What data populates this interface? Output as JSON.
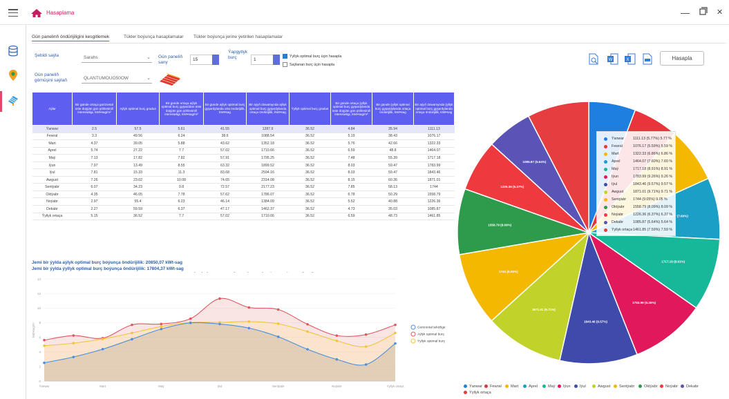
{
  "app": {
    "title": "Hasaplama"
  },
  "tabs": [
    {
      "label": "Gün panelinň öndürijiligini kesgitlemek",
      "active": true
    },
    {
      "label": "Tükler boýunça hasaplamalar",
      "active": false
    },
    {
      "label": "Tükler boýunça jerine ýetirilen hasaplamalar",
      "active": false
    }
  ],
  "form": {
    "city_label": "Şebidi saýla",
    "city_value": "Sarahs",
    "panel_count_label_1": "Gün paneliň",
    "panel_count_label_2": "sany",
    "panel_count_value": "15",
    "tilt_label_1": "Ýapgytlyk",
    "tilt_label_2": "burç",
    "tilt_value": "1",
    "chk_yearly_label": "Ýyllyk optimal burç üçin hasapla",
    "chk_yearly_checked": true,
    "chk_selected_label": "Saýlanan burç üçin hasapla",
    "chk_selected_checked": false,
    "panel_type_label_1": "Gün paneliň",
    "panel_type_label_2": "görnüşini saýlaň",
    "panel_type_value": "QLANTUMOUO50OW",
    "calc_button": "Hasapla"
  },
  "table": {
    "headers": [
      "Aýlar",
      "Bir günde ortaça gorizontal üste düşýän gün şöhlesiniň intensiwligi, kWt•sag/m²",
      "Aýlyk optimal burç gradus",
      "Bir günde ortaça aýlyk optimal burç gyşarddan üste düşýän gün şöhlesiniň intensiwligi, kWt•sag/m²",
      "Bir günde aýlyk optimal burç gyşardylanda orta öndürijilik, kWt•sag",
      "Bir aýyň dowamynda aýlyk optimal burç gyşardylanda ortaça öndürijilik, kWt•sag",
      "Ýyllyk optimal burç gradus",
      "Bir günde ortaça ýyllyk optimal burç gyşardylanda üste düşýän gün şöhlesiniň intensiwligi, kWt•sag/m²",
      "Bir günde ýyllyk optimal burç gyşardylanda ortaça öndürijilik, kWt•sag",
      "Bir aýyň dowamynda ýyllyk optimal burç gyşardylanda ortaça öndürijilik, kWt•sag"
    ],
    "rows": [
      [
        "Ýanwar",
        "2.5",
        "57.5",
        "5.61",
        "41.55",
        "1287.9",
        "36.52",
        "4.84",
        "35.94",
        "1111.13"
      ],
      [
        "Fewral",
        "3.3",
        "49.56",
        "6.24",
        "38.6",
        "1088.54",
        "36.52",
        "5.19",
        "38.43",
        "1076.17"
      ],
      [
        "Mart",
        "4.37",
        "39.05",
        "5.88",
        "43.62",
        "1352.18",
        "36.52",
        "5.76",
        "42.66",
        "1322.33"
      ],
      [
        "Aprel",
        "5.74",
        "27.22",
        "7.7",
        "57.02",
        "1710.66",
        "36.52",
        "6.59",
        "48.8",
        "1464.07"
      ],
      [
        "Maý",
        "7.13",
        "17.82",
        "7.82",
        "57.91",
        "1795.25",
        "36.52",
        "7.48",
        "55.39",
        "1717.18"
      ],
      [
        "Iýun",
        "7.97",
        "13.49",
        "8.55",
        "63.32",
        "1899.52",
        "36.52",
        "8.03",
        "59.47",
        "1783.99"
      ],
      [
        "Iýul",
        "7.81",
        "15.33",
        "11.3",
        "83.68",
        "2594.16",
        "36.52",
        "8.03",
        "59.47",
        "1843.46"
      ],
      [
        "Awgust",
        "7.26",
        "23.02",
        "10.08",
        "74.65",
        "2314.08",
        "36.52",
        "8.15",
        "60.36",
        "1871.01"
      ],
      [
        "Sentýabr",
        "6.07",
        "34.23",
        "9.8",
        "72.57",
        "2177.23",
        "36.52",
        "7.85",
        "58.13",
        "1744"
      ],
      [
        "Oktýabr",
        "4.35",
        "46.05",
        "7.78",
        "57.62",
        "1786.07",
        "36.52",
        "6.78",
        "50.29",
        "1558.79"
      ],
      [
        "Noýabr",
        "2.97",
        "55.4",
        "6.23",
        "46.14",
        "1384.09",
        "36.52",
        "5.52",
        "40.88",
        "1226.36"
      ],
      [
        "Dekabr",
        "2.27",
        "59.59",
        "6.37",
        "47.17",
        "1462.37",
        "36.52",
        "4.73",
        "35.03",
        "1085.87"
      ],
      [
        "Ýyllyk ortaça",
        "5.15",
        "36.52",
        "7.7",
        "57.02",
        "1710.66",
        "36.52",
        "6.59",
        "48.73",
        "1461.85"
      ]
    ]
  },
  "summary": {
    "line1": "Jemi bir ýylda aýlyk optimal burç boýunça öndürijilik: 20850,07 kWt-sag",
    "line2": "Jemi bir ýylda ýyllyk optimal burç boýunça öndürijilik: 17804,37 kWt-sag"
  },
  "chart_data": [
    {
      "type": "line",
      "title": "Gün radiasiýasynyň intensiwliginiň aýlar boýunça deňeşdirme grafigi",
      "ylabel": "kWt•sag/m²",
      "ylim": [
        0,
        14
      ],
      "yticks": [
        0,
        2,
        4,
        6,
        8,
        10,
        12,
        14
      ],
      "x": [
        "Ýanwar",
        "Fewral",
        "Mart",
        "Aprel",
        "Maý",
        "Iýun",
        "Iýul",
        "Awgust",
        "Sentýabr",
        "Oktýabr",
        "Noýabr",
        "Dekabr",
        "Ýyllyk ortaça"
      ],
      "xtick_labels": [
        "Ýanwar",
        "",
        "Mart",
        "",
        "Maý",
        "",
        "Iýul",
        "",
        "Sentýabr",
        "",
        "Noýabr",
        "",
        "Ýyllyk ortaça"
      ],
      "series": [
        {
          "name": "Gorizontal tekizlige",
          "color": "#4a90d9",
          "fill": true,
          "values": [
            2.5,
            3.3,
            4.37,
            5.74,
            7.13,
            7.97,
            7.81,
            7.26,
            6.07,
            4.35,
            2.97,
            2.27,
            5.15
          ]
        },
        {
          "name": "Aýlyk optimal burç",
          "color": "#e0575f",
          "fill": true,
          "values": [
            5.61,
            6.24,
            5.88,
            7.7,
            7.82,
            8.55,
            11.3,
            10.08,
            9.8,
            7.78,
            6.23,
            6.37,
            7.7
          ]
        },
        {
          "name": "Ýyllyk optimal burç",
          "color": "#f0c53a",
          "fill": true,
          "values": [
            4.84,
            5.19,
            5.76,
            6.59,
            7.48,
            8.03,
            8.03,
            8.15,
            7.85,
            6.78,
            5.52,
            4.73,
            6.59
          ]
        }
      ],
      "legend": "right",
      "grid": true
    },
    {
      "type": "pie",
      "slices": [
        {
          "name": "Ýanwar",
          "value": 1111.13,
          "pct": "5.77%",
          "color": "#1e7fe0"
        },
        {
          "name": "Fewral",
          "value": 1076.17,
          "pct": "5.59%",
          "color": "#e8343a"
        },
        {
          "name": "Mart",
          "value": 1322.33,
          "pct": "6.86%",
          "color": "#f5b800"
        },
        {
          "name": "Aprel",
          "value": 1464.07,
          "pct": "7.60%",
          "color": "#1b9fc7"
        },
        {
          "name": "Maý",
          "value": 1717.18,
          "pct": "8.91%",
          "color": "#17b79a"
        },
        {
          "name": "Iýun",
          "value": 1783.99,
          "pct": "9.26%",
          "color": "#e2185d"
        },
        {
          "name": "Iýul",
          "value": 1843.46,
          "pct": "9.57%",
          "color": "#3e4bab"
        },
        {
          "name": "Awgust",
          "value": 1871.01,
          "pct": "9.71%",
          "color": "#c1d22b"
        },
        {
          "name": "Sentýabr",
          "value": 1744,
          "pct": "9.05%",
          "color": "#f5b800"
        },
        {
          "name": "Oktýabr",
          "value": 1558.79,
          "pct": "8.09%",
          "color": "#2e9a4b"
        },
        {
          "name": "Noýabr",
          "value": 1226.36,
          "pct": "6.37%",
          "color": "#ee3a3f"
        },
        {
          "name": "Dekabr",
          "value": 1085.87,
          "pct": "5.64%",
          "color": "#5b54b7"
        },
        {
          "name": "Ýyllyk ortaça",
          "value": 1461.85,
          "pct": "7.59%",
          "color": "#e63d40"
        }
      ],
      "slice_labels": [
        "",
        "",
        "1322.33 (6.86%)",
        "1464.07 (7.60%)",
        "1717.18 (8.91%)",
        "1783.99 (9.26%)",
        "1843.46 (9.57%)",
        "1871.01 (9.71%)",
        "1744 (9.05%)",
        "1558.79 (8.09%)",
        "1226.36 (6.37%)",
        "1085.87 (5.64%)",
        ""
      ],
      "tooltip": [
        "1111.13 (5.77%) 5.77 %",
        "1076.17 (5.59%) 5.59 %",
        "1322.33 (6.86%) 6.86 %",
        "1464.07 (7.60%) 7.60 %",
        "1717.18 (8.91%) 8.91 %",
        "1783.99 (9.26%) 9.26 %",
        "1843.46 (9.57%) 9.57 %",
        "1871.01 (9.71%) 9.71 %",
        "1744 (9.05%) 9.05 %",
        "1558.79 (8.09%) 8.09 %",
        "1226.36 (6.37%) 6.37 %",
        "1085.87 (5.64%) 5.64 %",
        "1461.85 (7.59%) 7.59 %"
      ],
      "legend": "bottom"
    }
  ]
}
